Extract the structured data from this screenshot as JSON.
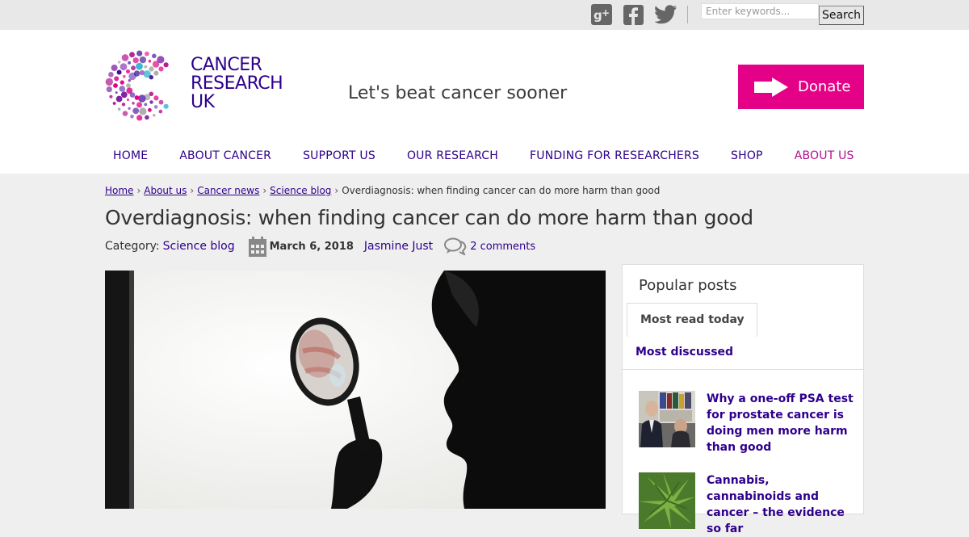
{
  "topbar": {
    "social_icons": [
      "google-plus-icon",
      "facebook-icon",
      "twitter-icon"
    ],
    "search": {
      "placeholder": "Enter keywords...",
      "value": "",
      "button_label": "Search"
    }
  },
  "header": {
    "logo_lines": [
      "CANCER",
      "RESEARCH",
      "UK"
    ],
    "tagline": "Let's beat cancer sooner",
    "donate_label": "Donate"
  },
  "nav": {
    "items": [
      "HOME",
      "ABOUT CANCER",
      "SUPPORT US",
      "OUR RESEARCH",
      "FUNDING FOR RESEARCHERS",
      "SHOP",
      "ABOUT US"
    ],
    "active_index": 6
  },
  "breadcrumb": {
    "links": [
      "Home",
      "About us",
      "Cancer news",
      "Science blog"
    ],
    "current": "Overdiagnosis: when finding cancer can do more harm than good"
  },
  "article": {
    "title": "Overdiagnosis: when finding cancer can do more harm than good",
    "category_label": "Category:",
    "category": "Science blog",
    "date": "March 6, 2018",
    "author": "Jasmine Just",
    "comments": "2 comments"
  },
  "sidebar": {
    "title": "Popular posts",
    "tabs": [
      "Most read today",
      "Most discussed"
    ],
    "active_tab": 0,
    "posts": [
      {
        "title": "Why a one-off PSA test for prostate cancer is doing men more harm than good"
      },
      {
        "title": "Cannabis, cannabinoids and cancer – the evidence so far"
      }
    ]
  },
  "colors": {
    "brand_purple": "#2e008b",
    "brand_pink": "#e40087",
    "active_nav": "#b0108c"
  }
}
